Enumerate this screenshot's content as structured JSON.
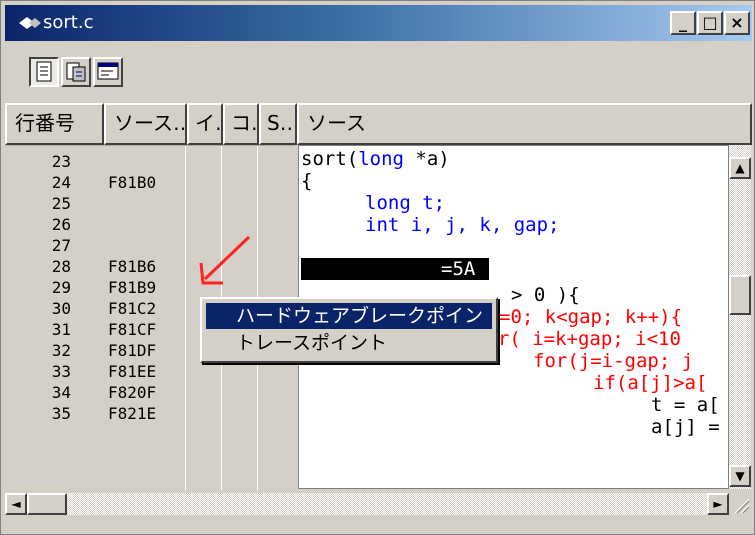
{
  "window": {
    "title": "sort.c",
    "buttons": {
      "minimize": "_",
      "maximize": "□",
      "close": "×"
    }
  },
  "toolbar": {
    "tools": [
      {
        "name": "source-view-icon",
        "pressed": true
      },
      {
        "name": "mixed-view-icon",
        "pressed": false
      },
      {
        "name": "disassembly-view-icon",
        "pressed": false
      }
    ]
  },
  "columns": [
    "行番号",
    "ソース…",
    "イ…",
    "コ…",
    "S…",
    "ソース"
  ],
  "rows": [
    {
      "line": "23",
      "addr": ""
    },
    {
      "line": "24",
      "addr": "F81B0"
    },
    {
      "line": "25",
      "addr": ""
    },
    {
      "line": "26",
      "addr": ""
    },
    {
      "line": "27",
      "addr": ""
    },
    {
      "line": "28",
      "addr": "F81B6"
    },
    {
      "line": "29",
      "addr": "F81B9"
    },
    {
      "line": "30",
      "addr": "F81C2"
    },
    {
      "line": "31",
      "addr": "F81CF"
    },
    {
      "line": "32",
      "addr": "F81DF"
    },
    {
      "line": "33",
      "addr": "F81EE"
    },
    {
      "line": "34",
      "addr": "F820F"
    },
    {
      "line": "35",
      "addr": "F821E"
    }
  ],
  "source_lines": {
    "l23a": "sort(",
    "l23b": "long",
    "l23c": " *a)",
    "l24": "{",
    "l25": "long t;",
    "l26": "int i, j, k, gap;",
    "l28": "=5A",
    "l29": "> 0 ){",
    "l30": "=0; k<gap; k++){",
    "l31": "for( i=k+gap; i<10",
    "l32": "for(j=i-gap; j",
    "l33": "if(a[j]>a[",
    "l34": "t = a[",
    "l35": "a[j] ="
  },
  "context_menu": {
    "items": [
      "ハードウェアブレークポイント",
      "トレースポイント"
    ],
    "highlight_color": "#0a246a"
  },
  "colors": {
    "keyword": "#0000ff",
    "text_red": "#ff0000",
    "arrow": "#ff2020",
    "title_start": "#0a246a",
    "title_end": "#a6caf0"
  }
}
